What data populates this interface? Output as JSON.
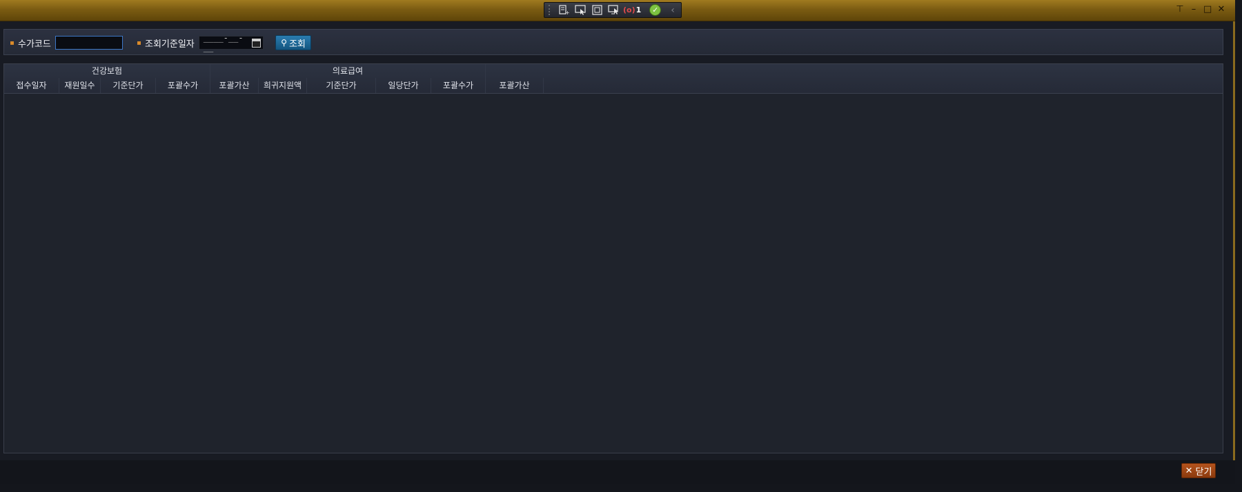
{
  "toolbar": {
    "icons": [
      "report-add-icon",
      "pointer-select-icon",
      "frame-icon",
      "screen-pointer-icon",
      "alarm-icon",
      "check-icon",
      "chevron-left-icon"
    ],
    "alarm_label": "(o)",
    "alarm_count": "1"
  },
  "window_controls": {
    "pin": "⊤",
    "minimize": "–",
    "maximize": "□",
    "close": "✕"
  },
  "search": {
    "code_label": "수가코드",
    "code_value": "",
    "date_label": "조회기준일자",
    "date_value": "____-__-__",
    "search_button": "조회"
  },
  "grid": {
    "groups": [
      {
        "label": "건강보험"
      },
      {
        "label": "의료급여"
      }
    ],
    "columns": [
      "접수일자",
      "재원일수",
      "기준단가",
      "포괄수가",
      "포괄가산",
      "희귀지원액",
      "기준단가",
      "일당단가",
      "포괄수가",
      "포괄가산"
    ],
    "rows": []
  },
  "footer": {
    "close_button": "닫기"
  },
  "colors": {
    "frame_gold": "#8a6b1e",
    "search_button": "#1d6a9a",
    "close_button": "#a0461a",
    "accent_bullet": "#d98a2a"
  }
}
